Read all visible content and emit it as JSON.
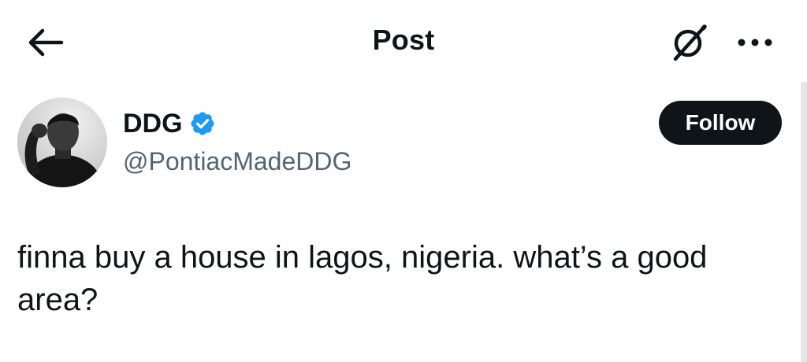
{
  "header": {
    "title": "Post",
    "back_icon": "arrow-left-icon",
    "grok_icon": "grok-icon",
    "more_icon": "more-horizontal-icon"
  },
  "author": {
    "display_name": "DDG",
    "handle": "@PontiacMadeDDG",
    "verified": true,
    "verified_color": "#1d9bf0",
    "avatar_icon": "avatar"
  },
  "follow_button": {
    "label": "Follow",
    "bg_color": "#0f1419"
  },
  "post": {
    "text": "finna buy a house in lagos, nigeria. what’s a good area?"
  }
}
